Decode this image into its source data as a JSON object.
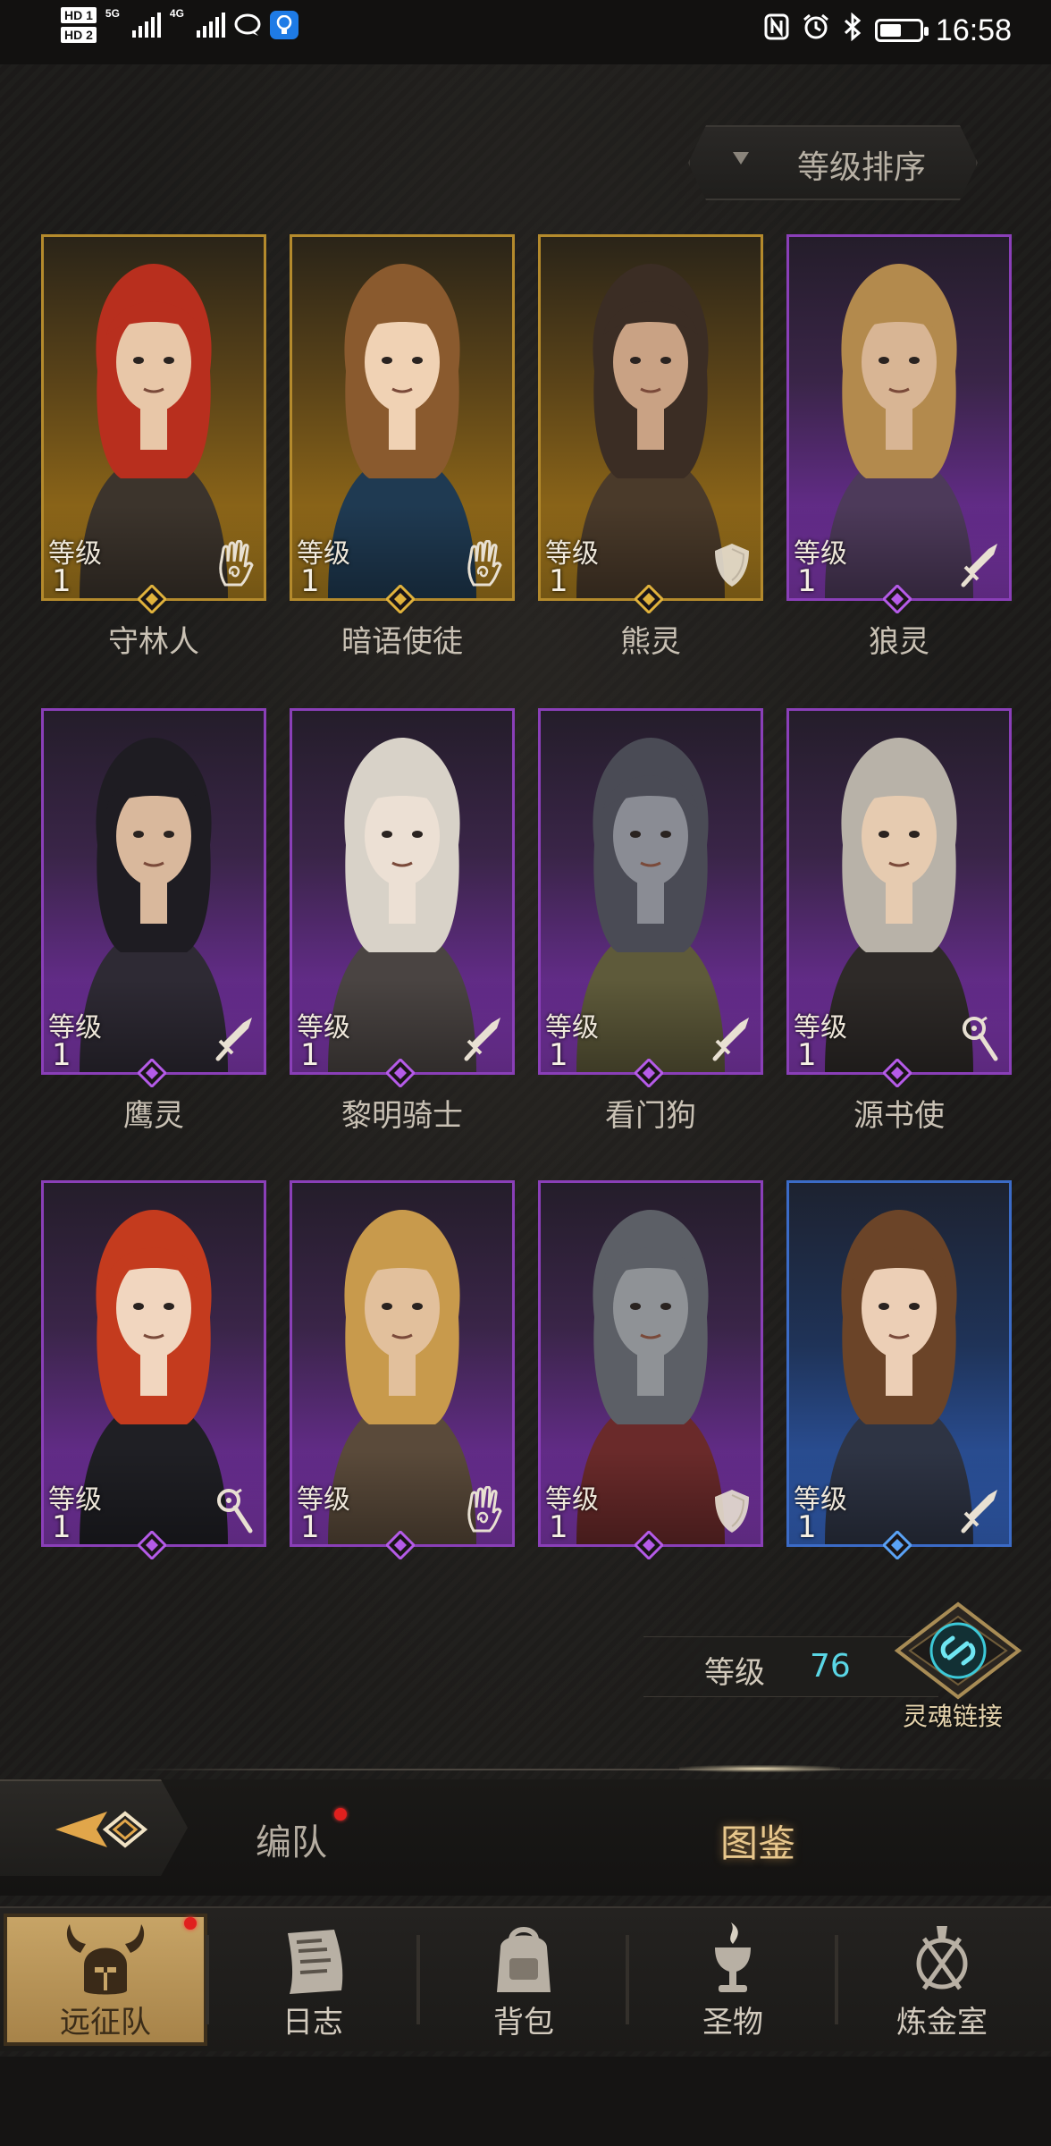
{
  "status_bar": {
    "sim1": "HD 1",
    "sim2": "HD 2",
    "net1": "5G",
    "net2": "4G",
    "time": "16:58",
    "battery_level": 0.55
  },
  "sort_button": {
    "label": "等级排序"
  },
  "level_label": "等级",
  "heroes": [
    {
      "name": "守林人",
      "level": "1",
      "rarity": "gold",
      "role": "hand-icon"
    },
    {
      "name": "暗语使徒",
      "level": "1",
      "rarity": "gold",
      "role": "hand-icon"
    },
    {
      "name": "熊灵",
      "level": "1",
      "rarity": "gold",
      "role": "shield-icon"
    },
    {
      "name": "狼灵",
      "level": "1",
      "rarity": "purple",
      "role": "sword-icon"
    },
    {
      "name": "鹰灵",
      "level": "1",
      "rarity": "purple",
      "role": "sword-icon"
    },
    {
      "name": "黎明骑士",
      "level": "1",
      "rarity": "purple",
      "role": "sword-icon"
    },
    {
      "name": "看门狗",
      "level": "1",
      "rarity": "purple",
      "role": "sword-icon"
    },
    {
      "name": "源书使",
      "level": "1",
      "rarity": "purple",
      "role": "staff-icon"
    },
    {
      "name": "",
      "level": "1",
      "rarity": "purple",
      "role": "staff-icon"
    },
    {
      "name": "",
      "level": "1",
      "rarity": "purple",
      "role": "hand-icon"
    },
    {
      "name": "",
      "level": "1",
      "rarity": "purple",
      "role": "shield-icon"
    },
    {
      "name": "",
      "level": "1",
      "rarity": "blue",
      "role": "sword-icon"
    }
  ],
  "soul_link": {
    "level_key": "等级",
    "level_value": "76",
    "label": "灵魂链接"
  },
  "tabs": {
    "formation": "编队",
    "codex": "图鉴"
  },
  "nav": [
    {
      "label": "远征队",
      "icon": "helmet-icon",
      "active": true
    },
    {
      "label": "日志",
      "icon": "scroll-icon",
      "active": false
    },
    {
      "label": "背包",
      "icon": "backpack-icon",
      "active": false
    },
    {
      "label": "圣物",
      "icon": "chalice-icon",
      "active": false
    },
    {
      "label": "炼金室",
      "icon": "alchemy-icon",
      "active": false
    }
  ],
  "colors": {
    "gold": "#b48a2c",
    "purple": "#8a3fb8",
    "blue": "#3b6bc7",
    "level_value": "#5ad6e5",
    "accent_tab": "#e8c78c"
  }
}
